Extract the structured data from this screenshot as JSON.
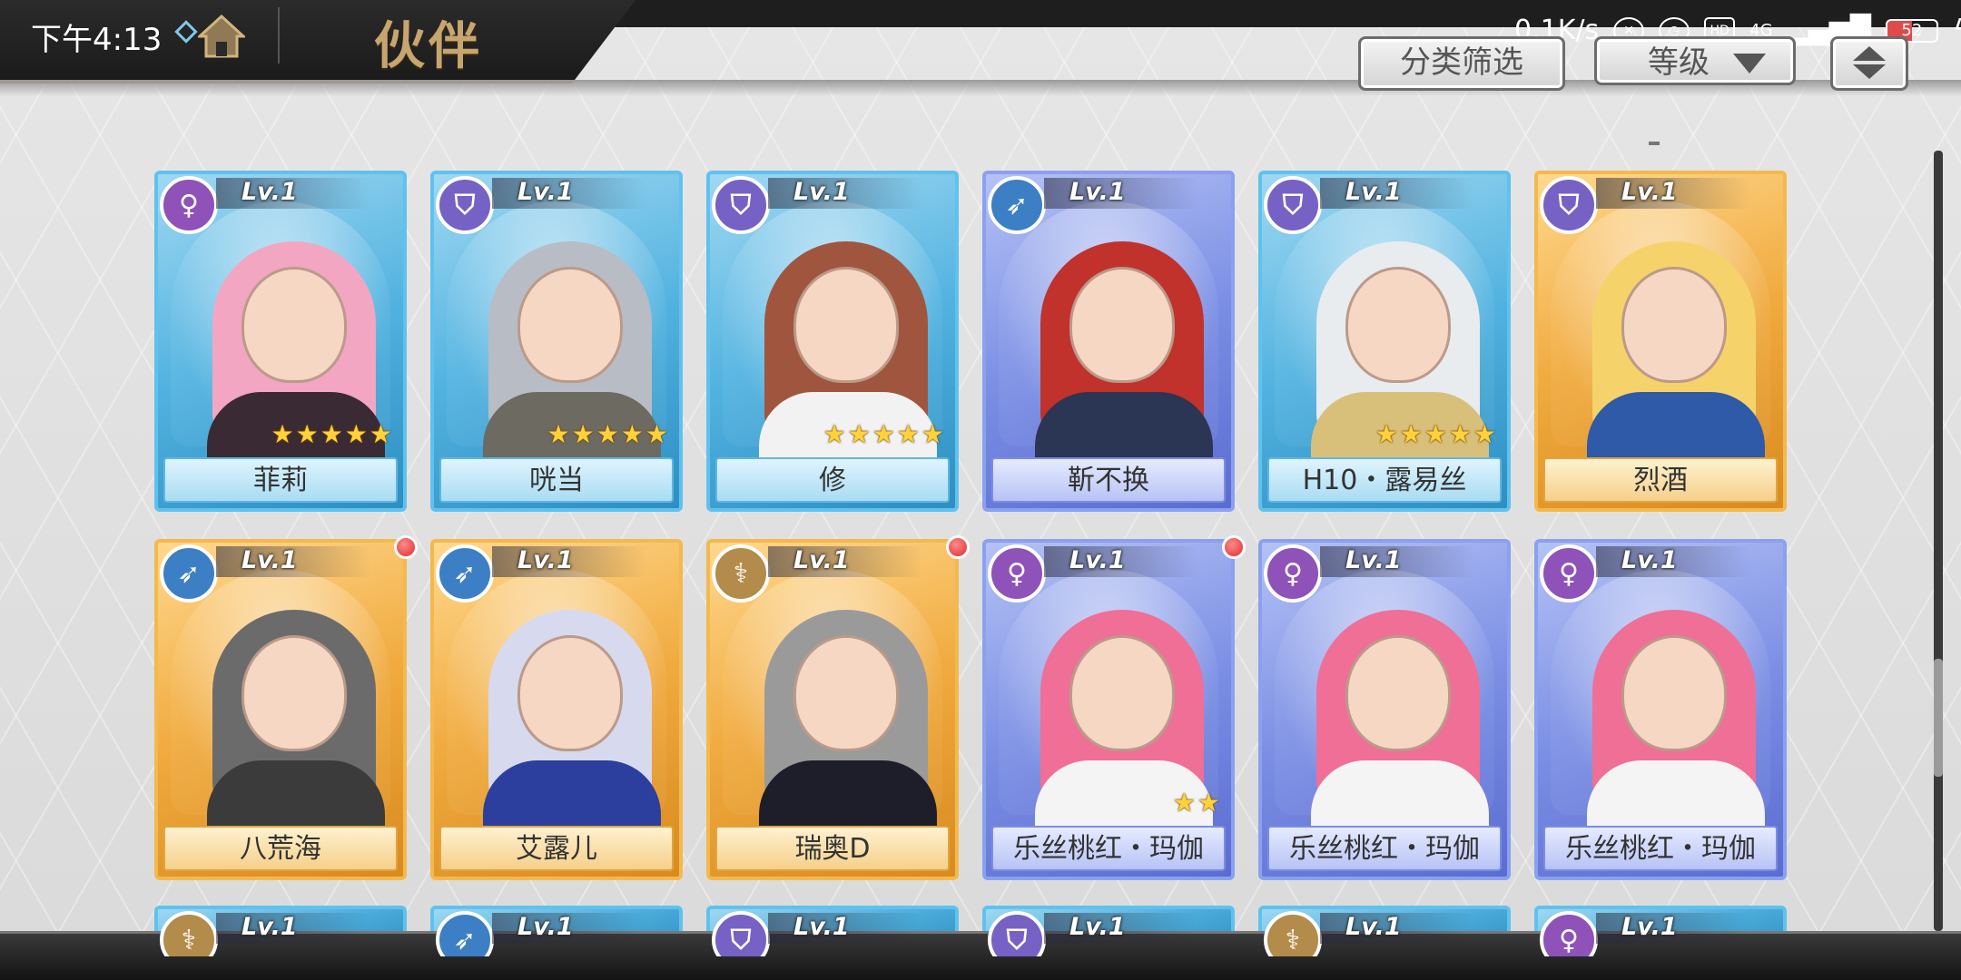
{
  "status_bar": {
    "time": "下午4:13",
    "network_speed": "0.1K/s",
    "hd_label": "HD",
    "signal_label": "4G",
    "battery": "52"
  },
  "header": {
    "title": "伙伴",
    "home_icon": "home-icon",
    "filter_label": "分类筛选",
    "sort_label": "等级",
    "sort_order_icon": "sort-order-icon"
  },
  "partners": [
    {
      "name": "菲莉",
      "level": "Lv.1",
      "frame": "blue",
      "class_icon": "sigil-icon",
      "stars": 5,
      "stars_text": "★★★★★",
      "has_new": false,
      "hair": "#f2a6c2",
      "outfit": "#3a2a33"
    },
    {
      "name": "咣当",
      "level": "Lv.1",
      "frame": "blue",
      "class_icon": "shield-icon",
      "stars": 5,
      "stars_text": "★★★★★",
      "has_new": false,
      "hair": "#b8bcc4",
      "outfit": "#6d6a62"
    },
    {
      "name": "修",
      "level": "Lv.1",
      "frame": "blue",
      "class_icon": "shield-icon",
      "stars": 5,
      "stars_text": "★★★★★",
      "has_new": false,
      "hair": "#a0553e",
      "outfit": "#f2f2f2"
    },
    {
      "name": "靳不换",
      "level": "Lv.1",
      "frame": "purple",
      "class_icon": "bow-icon",
      "stars": 0,
      "stars_text": "",
      "has_new": false,
      "hair": "#c0322b",
      "outfit": "#2b3554"
    },
    {
      "name": "H10・露易丝",
      "level": "Lv.1",
      "frame": "blue",
      "class_icon": "shield-icon",
      "stars": 5,
      "stars_text": "★★★★★",
      "has_new": false,
      "hair": "#e9ecef",
      "outfit": "#d9c07a"
    },
    {
      "name": "烈酒",
      "level": "Lv.1",
      "frame": "gold",
      "class_icon": "shield-icon",
      "stars": 0,
      "stars_text": "",
      "has_new": false,
      "hair": "#f6d36a",
      "outfit": "#2e5aa8"
    },
    {
      "name": "八荒海",
      "level": "Lv.1",
      "frame": "gold",
      "class_icon": "bow-icon",
      "stars": 0,
      "stars_text": "",
      "has_new": true,
      "hair": "#6b6b6b",
      "outfit": "#3b3b3b"
    },
    {
      "name": "艾露儿",
      "level": "Lv.1",
      "frame": "gold",
      "class_icon": "bow-icon",
      "stars": 0,
      "stars_text": "",
      "has_new": false,
      "hair": "#d7d9ee",
      "outfit": "#2c3f9e"
    },
    {
      "name": "瑞奥D",
      "level": "Lv.1",
      "frame": "gold",
      "class_icon": "staff-icon",
      "stars": 0,
      "stars_text": "",
      "has_new": true,
      "hair": "#9a9a9a",
      "outfit": "#1e1e2a"
    },
    {
      "name": "乐丝桃红・玛伽",
      "level": "Lv.1",
      "frame": "purple",
      "class_icon": "sigil-icon",
      "stars": 2,
      "stars_text": "★★",
      "has_new": true,
      "hair": "#ef6f97",
      "outfit": "#f4f4f4"
    },
    {
      "name": "乐丝桃红・玛伽",
      "level": "Lv.1",
      "frame": "purple",
      "class_icon": "sigil-icon",
      "stars": 0,
      "stars_text": "",
      "has_new": false,
      "hair": "#ef6f97",
      "outfit": "#f4f4f4"
    },
    {
      "name": "乐丝桃红・玛伽",
      "level": "Lv.1",
      "frame": "purple",
      "class_icon": "sigil-icon",
      "stars": 0,
      "stars_text": "",
      "has_new": false,
      "hair": "#ef6f97",
      "outfit": "#f4f4f4"
    }
  ],
  "partial_row": [
    {
      "level": "Lv.1",
      "frame": "blue",
      "class_icon": "staff-icon"
    },
    {
      "level": "Lv.1",
      "frame": "blue",
      "class_icon": "bow-icon"
    },
    {
      "level": "Lv.1",
      "frame": "blue",
      "class_icon": "shield-icon"
    },
    {
      "level": "Lv.1",
      "frame": "blue",
      "class_icon": "shield-icon"
    },
    {
      "level": "Lv.1",
      "frame": "blue",
      "class_icon": "staff-icon"
    },
    {
      "level": "Lv.1",
      "frame": "blue",
      "class_icon": "sigil-icon"
    }
  ]
}
